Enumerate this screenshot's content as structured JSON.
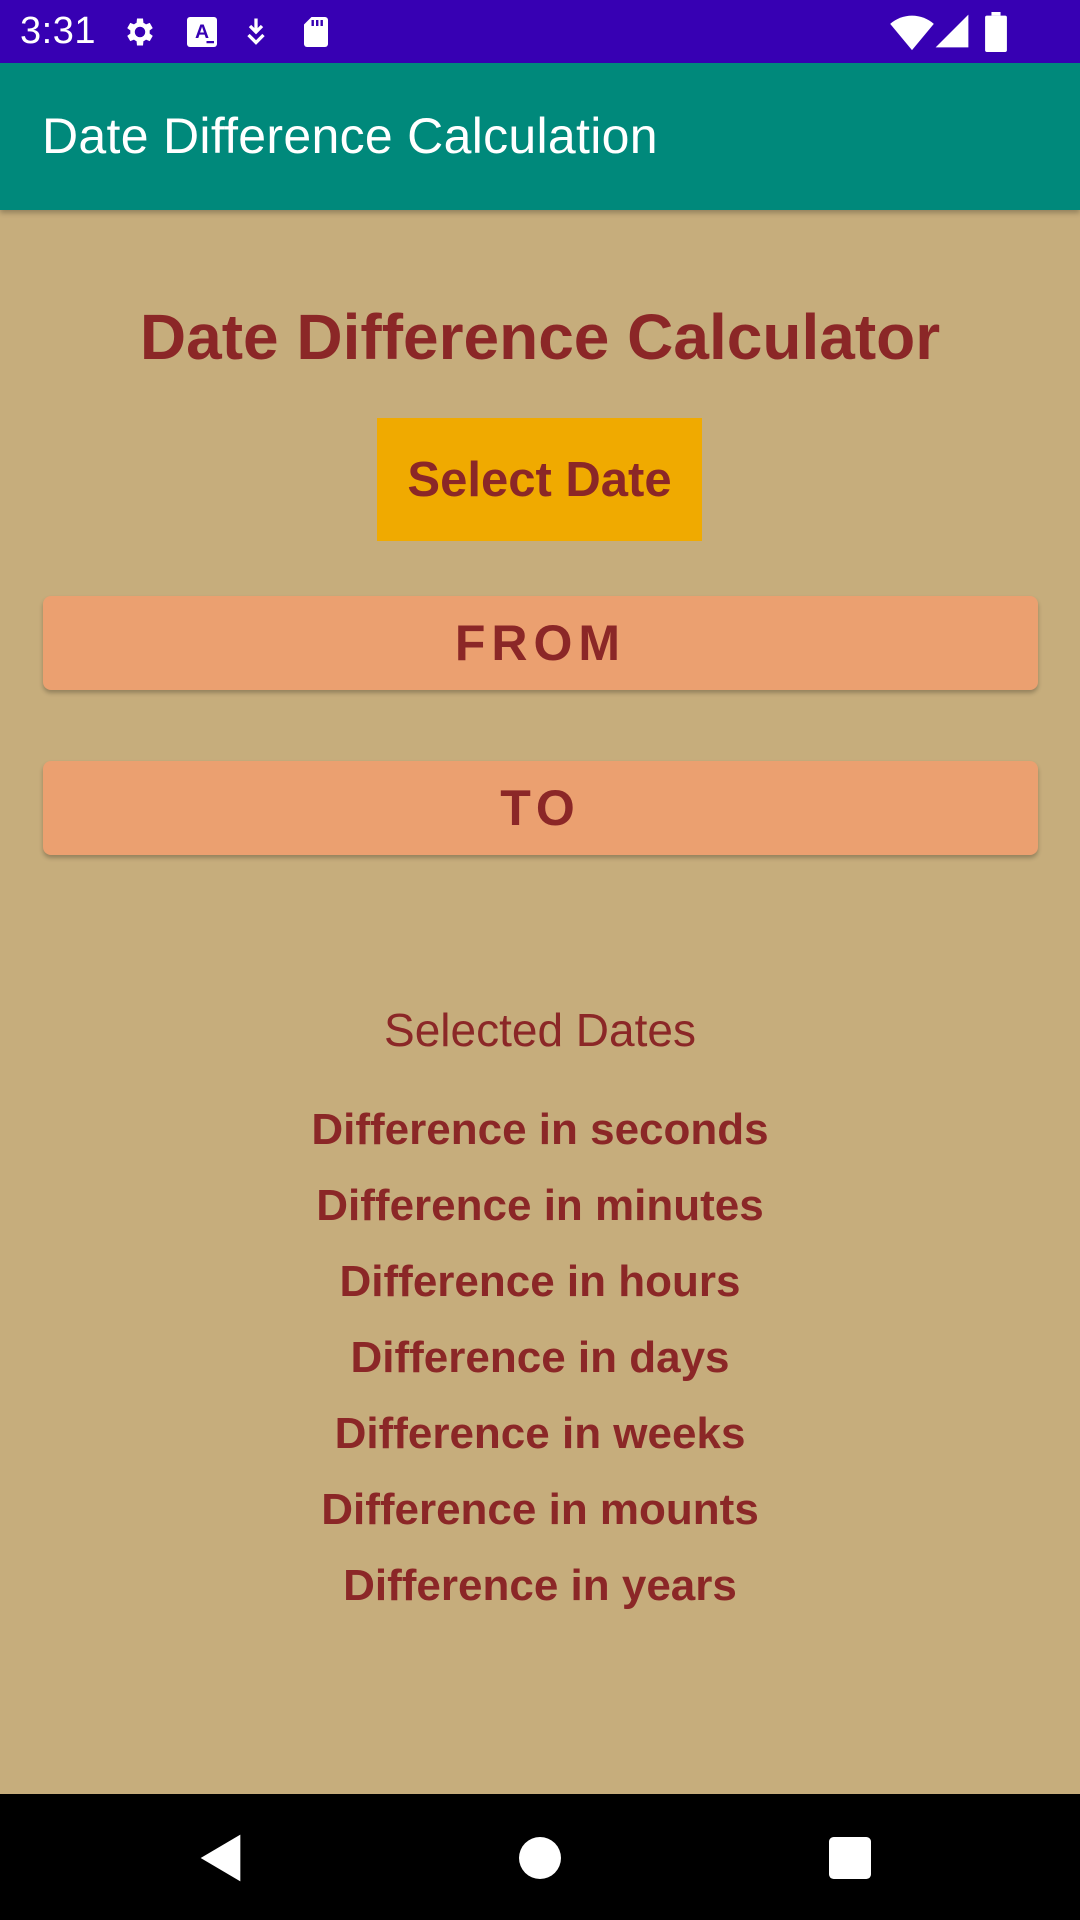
{
  "status_bar": {
    "time": "3:31",
    "icons": [
      "gear-icon",
      "a-notification-icon",
      "download-icon",
      "sd-card-icon",
      "wifi-icon",
      "signal-icon",
      "battery-icon"
    ]
  },
  "app_bar": {
    "title": "Date Difference Calculation",
    "color": "#00897b"
  },
  "main": {
    "heading": "Date Difference Calculator",
    "select_date_label": "Select Date",
    "from_label": "FROM",
    "to_label": "TO",
    "selected_dates_label": "Selected Dates",
    "differences": [
      "Difference in seconds",
      "Difference in minutes",
      "Difference in hours",
      "Difference in days",
      "Difference in weeks",
      "Difference in mounts",
      "Difference in years"
    ]
  },
  "colors": {
    "status_bar": "#3700b3",
    "background": "#c6ad7c",
    "text_accent": "#8b2727",
    "select_button": "#f0aa00",
    "range_button": "#eba070"
  },
  "nav_bar": {
    "icons": [
      "back-icon",
      "home-icon",
      "recents-icon"
    ]
  }
}
